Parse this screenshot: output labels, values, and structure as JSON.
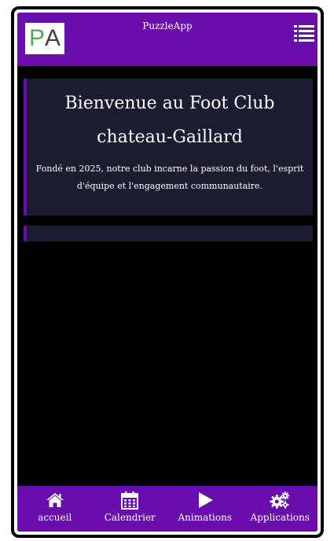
{
  "app": {
    "title": "PuzzleApp",
    "logo_text_first": "P",
    "logo_text_second": "A",
    "logo_first_color": "#55a85a",
    "logo_second_color": "#404040"
  },
  "header": {
    "menu_icon": "list-menu-icon",
    "background_color": "#6a0dad"
  },
  "hero": {
    "title": "Bienvenue au Foot Club chateau-Gaillard",
    "description": "Fondé en 2025, notre club incarne la passion du foot, l'esprit d'équipe et l'engagement communautaire."
  },
  "bottom_nav": {
    "items": [
      {
        "label": "accueil",
        "icon": "home-icon"
      },
      {
        "label": "Calendrier",
        "icon": "calendar-icon"
      },
      {
        "label": "Animations",
        "icon": "play-icon"
      },
      {
        "label": "Applications",
        "icon": "gears-icon"
      }
    ]
  },
  "colors": {
    "accent": "#6a0dad",
    "card_background": "#1c1c30",
    "page_background": "#000000"
  }
}
